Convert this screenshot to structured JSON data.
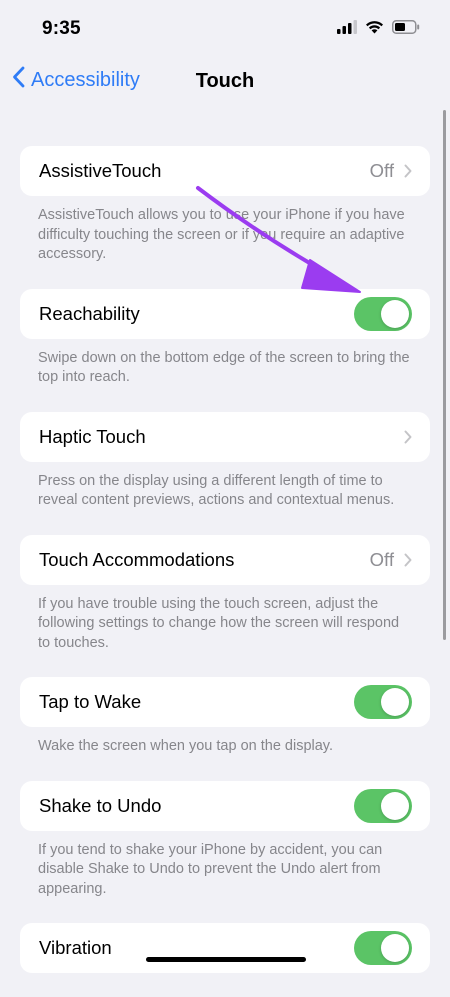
{
  "status_bar": {
    "time": "9:35",
    "icons": [
      "signal-icon",
      "wifi-icon",
      "battery-icon"
    ]
  },
  "nav": {
    "back_label": "Accessibility",
    "title": "Touch"
  },
  "groups": [
    {
      "label": "AssistiveTouch",
      "value": "Off",
      "control": "chevron",
      "footer": "AssistiveTouch allows you to use your iPhone if you have difficulty touching the screen or if you require an adaptive accessory."
    },
    {
      "label": "Reachability",
      "control": "toggle",
      "on": true,
      "footer": "Swipe down on the bottom edge of the screen to bring the top into reach."
    },
    {
      "label": "Haptic Touch",
      "control": "chevron",
      "footer": "Press on the display using a different length of time to reveal content previews, actions and contextual menus."
    },
    {
      "label": "Touch Accommodations",
      "value": "Off",
      "control": "chevron",
      "footer": "If you have trouble using the touch screen, adjust the following settings to change how the screen will respond to touches."
    },
    {
      "label": "Tap to Wake",
      "control": "toggle",
      "on": true,
      "footer": "Wake the screen when you tap on the display."
    },
    {
      "label": "Shake to Undo",
      "control": "toggle",
      "on": true,
      "footer": "If you tend to shake your iPhone by accident, you can disable Shake to Undo to prevent the Undo alert from appearing."
    },
    {
      "label": "Vibration",
      "control": "toggle",
      "on": true
    }
  ],
  "colors": {
    "accent": "#2f7cf6",
    "toggle_on": "#5bc466",
    "annotation_arrow": "#9b3cf0",
    "background": "#f1f1f6"
  }
}
